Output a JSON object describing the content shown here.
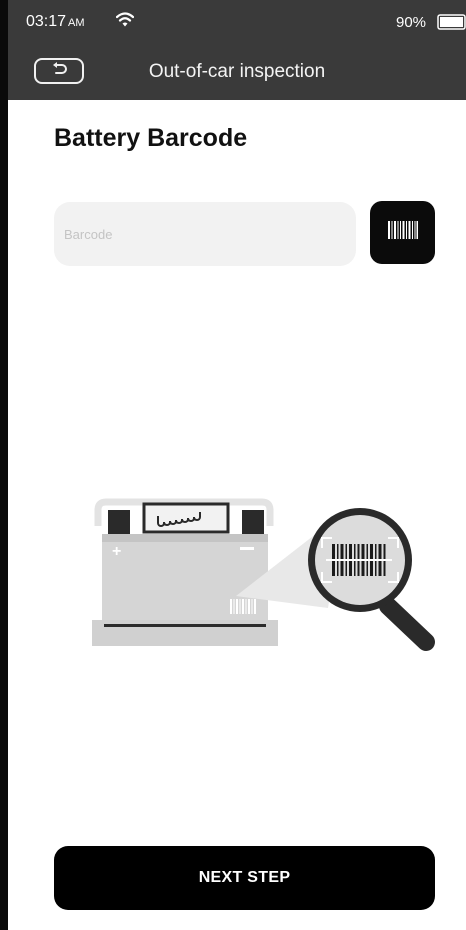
{
  "status_bar": {
    "time": "03:17",
    "ampm": "AM",
    "battery_percent": "90%"
  },
  "header": {
    "title": "Out-of-car inspection"
  },
  "main": {
    "title": "Battery Barcode",
    "barcode_field": {
      "placeholder": "Barcode",
      "value": ""
    }
  },
  "footer": {
    "next_label": "NEXT STEP"
  },
  "icons": {
    "back": "back-arrow-icon",
    "scan": "barcode-scan-icon",
    "wifi": "wifi-icon",
    "battery": "battery-icon"
  },
  "colors": {
    "header_bg": "#3a3a3a",
    "button_bg": "#000000",
    "input_bg": "#f2f2f2"
  }
}
